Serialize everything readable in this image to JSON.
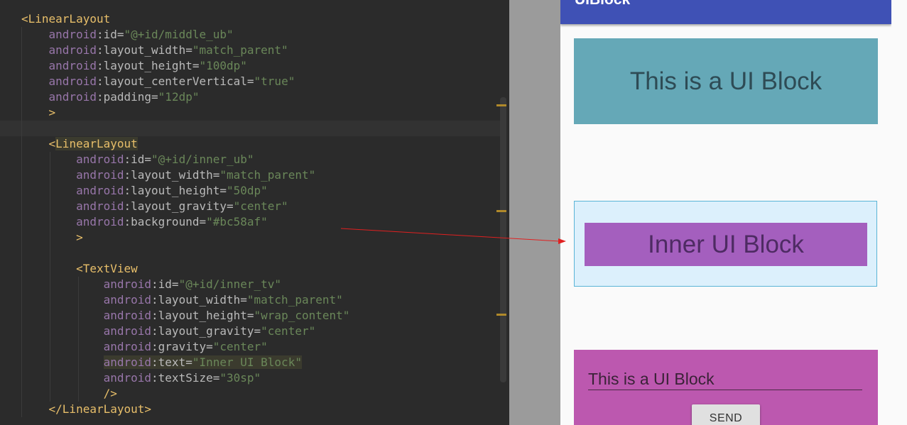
{
  "editor": {
    "lines": [
      {
        "indent": "",
        "parts": [
          [
            "tag",
            "<LinearLayout"
          ]
        ]
      },
      {
        "indent": "    ",
        "parts": [
          [
            "ns",
            "android"
          ],
          [
            "attr",
            ":id="
          ],
          [
            "val",
            "\"@+id/middle_ub\""
          ]
        ]
      },
      {
        "indent": "    ",
        "parts": [
          [
            "ns",
            "android"
          ],
          [
            "attr",
            ":layout_width="
          ],
          [
            "val",
            "\"match_parent\""
          ]
        ]
      },
      {
        "indent": "    ",
        "parts": [
          [
            "ns",
            "android"
          ],
          [
            "attr",
            ":layout_height="
          ],
          [
            "val",
            "\"100dp\""
          ]
        ]
      },
      {
        "indent": "    ",
        "parts": [
          [
            "ns",
            "android"
          ],
          [
            "attr",
            ":layout_centerVertical="
          ],
          [
            "val",
            "\"true\""
          ]
        ]
      },
      {
        "indent": "    ",
        "parts": [
          [
            "ns",
            "android"
          ],
          [
            "attr",
            ":padding="
          ],
          [
            "val",
            "\"12dp\""
          ]
        ]
      },
      {
        "indent": "    ",
        "parts": [
          [
            "tag",
            ">"
          ]
        ]
      },
      {
        "indent": "",
        "parts": []
      },
      {
        "indent": "    ",
        "parts": [
          [
            "tag",
            "<"
          ],
          [
            "hl",
            "LinearLayout"
          ]
        ]
      },
      {
        "indent": "        ",
        "parts": [
          [
            "ns",
            "android"
          ],
          [
            "attr",
            ":id="
          ],
          [
            "val",
            "\"@+id/inner_ub\""
          ]
        ]
      },
      {
        "indent": "        ",
        "parts": [
          [
            "ns",
            "android"
          ],
          [
            "attr",
            ":layout_width="
          ],
          [
            "val",
            "\"match_parent\""
          ]
        ]
      },
      {
        "indent": "        ",
        "parts": [
          [
            "ns",
            "android"
          ],
          [
            "attr",
            ":layout_height="
          ],
          [
            "val",
            "\"50dp\""
          ]
        ]
      },
      {
        "indent": "        ",
        "parts": [
          [
            "ns",
            "android"
          ],
          [
            "attr",
            ":layout_gravity="
          ],
          [
            "val",
            "\"center\""
          ]
        ]
      },
      {
        "indent": "        ",
        "parts": [
          [
            "ns",
            "android"
          ],
          [
            "attr",
            ":background="
          ],
          [
            "val",
            "\"#bc58af\""
          ]
        ]
      },
      {
        "indent": "        ",
        "parts": [
          [
            "tag",
            ">"
          ]
        ]
      },
      {
        "indent": "",
        "parts": []
      },
      {
        "indent": "        ",
        "parts": [
          [
            "tag",
            "<TextView"
          ]
        ]
      },
      {
        "indent": "            ",
        "parts": [
          [
            "ns",
            "android"
          ],
          [
            "attr",
            ":id="
          ],
          [
            "val",
            "\"@+id/inner_tv\""
          ]
        ]
      },
      {
        "indent": "            ",
        "parts": [
          [
            "ns",
            "android"
          ],
          [
            "attr",
            ":layout_width="
          ],
          [
            "val",
            "\"match_parent\""
          ]
        ]
      },
      {
        "indent": "            ",
        "parts": [
          [
            "ns",
            "android"
          ],
          [
            "attr",
            ":layout_height="
          ],
          [
            "val",
            "\"wrap_content\""
          ]
        ]
      },
      {
        "indent": "            ",
        "parts": [
          [
            "ns",
            "android"
          ],
          [
            "attr",
            ":layout_gravity="
          ],
          [
            "val",
            "\"center\""
          ]
        ]
      },
      {
        "indent": "            ",
        "parts": [
          [
            "ns",
            "android"
          ],
          [
            "attr",
            ":gravity="
          ],
          [
            "val",
            "\"center\""
          ]
        ]
      },
      {
        "indent": "            ",
        "parts": [
          [
            "hlns",
            "android"
          ],
          [
            "hlattr",
            ":text="
          ],
          [
            "hlval",
            "\"Inner UI Block\""
          ]
        ]
      },
      {
        "indent": "            ",
        "parts": [
          [
            "ns",
            "android"
          ],
          [
            "attr",
            ":textSize="
          ],
          [
            "val",
            "\"30sp\""
          ]
        ]
      },
      {
        "indent": "            ",
        "parts": [
          [
            "tag",
            "/>"
          ]
        ]
      },
      {
        "indent": "    ",
        "parts": [
          [
            "tag",
            "</LinearLayout>"
          ]
        ]
      }
    ]
  },
  "preview": {
    "app_title": "UIBlock",
    "block1_text": "This is a UI Block",
    "inner_text": "Inner UI Block",
    "edittext_value": "This is a UI Block",
    "send_label": "SEND"
  },
  "colors": {
    "appbar": "#3f51b5",
    "block1": "#65a8b7",
    "middle": "#dcf0fc",
    "inner": "#a45fbe",
    "block3": "#bc58af",
    "arrow": "#e02020"
  }
}
